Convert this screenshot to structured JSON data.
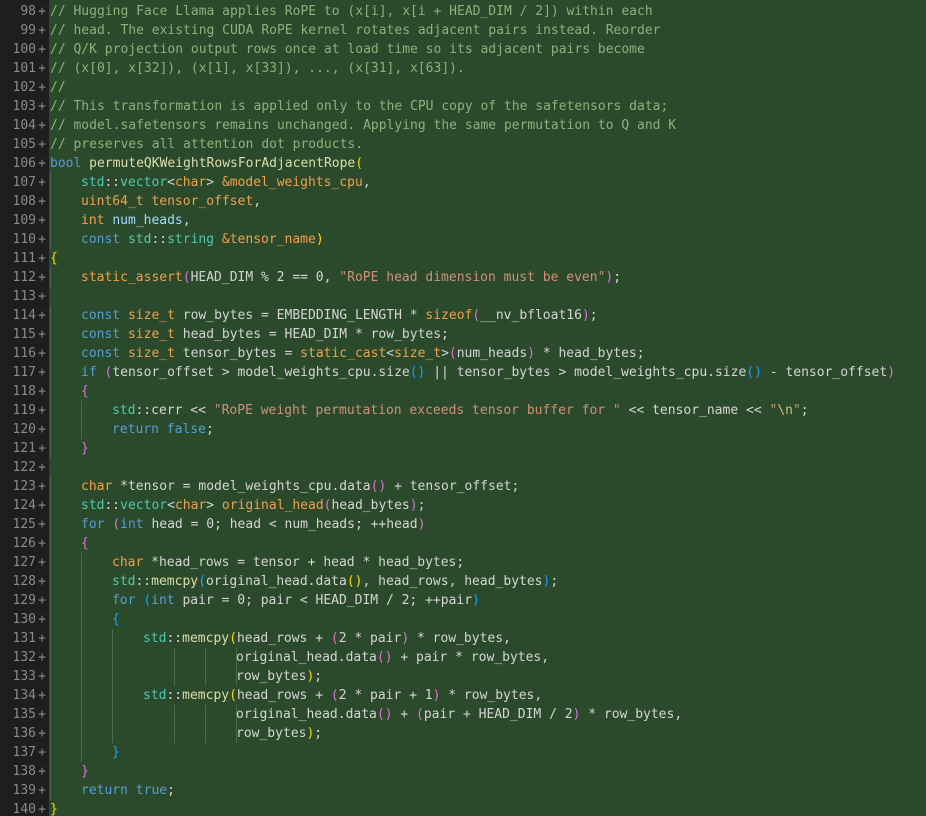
{
  "editor": {
    "diff_marker": "+",
    "lines": [
      {
        "n": "98",
        "i": 0,
        "t": [
          [
            "cm",
            "// Hugging Face Llama applies RoPE to (x[i], x[i + HEAD_DIM / 2]) within each"
          ]
        ]
      },
      {
        "n": "99",
        "i": 0,
        "t": [
          [
            "cm",
            "// head. The existing CUDA RoPE kernel rotates adjacent pairs instead. Reorder"
          ]
        ]
      },
      {
        "n": "100",
        "i": 0,
        "t": [
          [
            "cm",
            "// Q/K projection output rows once at load time so its adjacent pairs become"
          ]
        ]
      },
      {
        "n": "101",
        "i": 0,
        "t": [
          [
            "cm",
            "// (x[0], x[32]), (x[1], x[33]), ..., (x[31], x[63])."
          ]
        ]
      },
      {
        "n": "102",
        "i": 0,
        "t": [
          [
            "cm",
            "//"
          ]
        ]
      },
      {
        "n": "103",
        "i": 0,
        "t": [
          [
            "cm",
            "// This transformation is applied only to the CPU copy of the safetensors data;"
          ]
        ]
      },
      {
        "n": "104",
        "i": 0,
        "t": [
          [
            "cm",
            "// model.safetensors remains unchanged. Applying the same permutation to Q and K"
          ]
        ]
      },
      {
        "n": "105",
        "i": 0,
        "t": [
          [
            "cm",
            "// preserves all attention dot products."
          ]
        ]
      },
      {
        "n": "106",
        "i": 0,
        "t": [
          [
            "kw",
            "bool"
          ],
          [
            "",
            " "
          ],
          [
            "fn",
            "permuteQKWeightRowsForAdjacentRope"
          ],
          [
            "br",
            "("
          ]
        ]
      },
      {
        "n": "107",
        "i": 1,
        "t": [
          [
            "ns",
            "std"
          ],
          [
            "",
            "::"
          ],
          [
            "ns",
            "vector"
          ],
          [
            "",
            "<"
          ],
          [
            "ty",
            "char"
          ],
          [
            "",
            "> "
          ],
          [
            "ty",
            "&model_weights_cpu"
          ],
          [
            "",
            ","
          ]
        ]
      },
      {
        "n": "108",
        "i": 1,
        "t": [
          [
            "ty",
            "uint64_t tensor_offset"
          ],
          [
            "",
            ","
          ]
        ]
      },
      {
        "n": "109",
        "i": 1,
        "t": [
          [
            "ty",
            "int"
          ],
          [
            "",
            " "
          ],
          [
            "pr",
            "num_heads"
          ],
          [
            "",
            ","
          ]
        ]
      },
      {
        "n": "110",
        "i": 1,
        "t": [
          [
            "kw",
            "const"
          ],
          [
            "",
            " "
          ],
          [
            "ns",
            "std"
          ],
          [
            "",
            "::"
          ],
          [
            "ns",
            "string"
          ],
          [
            "",
            " "
          ],
          [
            "ty",
            "&tensor_name"
          ],
          [
            "br",
            ")"
          ]
        ]
      },
      {
        "n": "111",
        "i": 0,
        "t": [
          [
            "br",
            "{"
          ]
        ]
      },
      {
        "n": "112",
        "i": 1,
        "t": [
          [
            "ty",
            "static_assert"
          ],
          [
            "br2",
            "("
          ],
          [
            "",
            "HEAD_DIM % 2 == 0, "
          ],
          [
            "st",
            "\"RoPE head dimension must be even\""
          ],
          [
            "br2",
            ")"
          ],
          [
            "",
            ";"
          ]
        ]
      },
      {
        "n": "113",
        "i": 0,
        "t": [
          [
            "",
            ""
          ]
        ]
      },
      {
        "n": "114",
        "i": 1,
        "t": [
          [
            "kw",
            "const"
          ],
          [
            "",
            " "
          ],
          [
            "ty",
            "size_t"
          ],
          [
            "",
            " row_bytes = EMBEDDING_LENGTH * "
          ],
          [
            "ty",
            "sizeof"
          ],
          [
            "br2",
            "("
          ],
          [
            "",
            "__nv_bfloat16"
          ],
          [
            "br2",
            ")"
          ],
          [
            "",
            ";"
          ]
        ]
      },
      {
        "n": "115",
        "i": 1,
        "t": [
          [
            "kw",
            "const"
          ],
          [
            "",
            " "
          ],
          [
            "ty",
            "size_t"
          ],
          [
            "",
            " head_bytes = HEAD_DIM * row_bytes;"
          ]
        ]
      },
      {
        "n": "116",
        "i": 1,
        "t": [
          [
            "kw",
            "const"
          ],
          [
            "",
            " "
          ],
          [
            "ty",
            "size_t"
          ],
          [
            "",
            " tensor_bytes = "
          ],
          [
            "ty",
            "static_cast"
          ],
          [
            "",
            "<"
          ],
          [
            "ty",
            "size_t"
          ],
          [
            "",
            ">"
          ],
          [
            "br2",
            "("
          ],
          [
            "",
            "num_heads"
          ],
          [
            "br2",
            ")"
          ],
          [
            "",
            " * head_bytes;"
          ]
        ]
      },
      {
        "n": "117",
        "i": 1,
        "t": [
          [
            "kw",
            "if"
          ],
          [
            "",
            " "
          ],
          [
            "br2",
            "("
          ],
          [
            "",
            "tensor_offset > model_weights_cpu.size"
          ],
          [
            "br3",
            "()"
          ],
          [
            "",
            " || tensor_bytes > model_weights_cpu.size"
          ],
          [
            "br3",
            "()"
          ],
          [
            "",
            " - tensor_offset"
          ],
          [
            "br2",
            ")"
          ]
        ]
      },
      {
        "n": "118",
        "i": 1,
        "t": [
          [
            "br2",
            "{"
          ]
        ]
      },
      {
        "n": "119",
        "i": 2,
        "t": [
          [
            "ns",
            "std"
          ],
          [
            "",
            "::cerr << "
          ],
          [
            "st",
            "\"RoPE weight permutation exceeds tensor buffer for \""
          ],
          [
            "",
            " << tensor_name << "
          ],
          [
            "st",
            "\""
          ],
          [
            "es",
            "\\n"
          ],
          [
            "st",
            "\""
          ],
          [
            "",
            ";"
          ]
        ]
      },
      {
        "n": "120",
        "i": 2,
        "t": [
          [
            "kw",
            "return"
          ],
          [
            "",
            " "
          ],
          [
            "kw",
            "false"
          ],
          [
            "",
            ";"
          ]
        ]
      },
      {
        "n": "121",
        "i": 1,
        "t": [
          [
            "br2",
            "}"
          ]
        ]
      },
      {
        "n": "122",
        "i": 0,
        "t": [
          [
            "",
            ""
          ]
        ]
      },
      {
        "n": "123",
        "i": 1,
        "t": [
          [
            "ty",
            "char"
          ],
          [
            "",
            " *tensor = model_weights_cpu.data"
          ],
          [
            "br2",
            "()"
          ],
          [
            "",
            " + tensor_offset;"
          ]
        ]
      },
      {
        "n": "124",
        "i": 1,
        "t": [
          [
            "ns",
            "std"
          ],
          [
            "",
            "::"
          ],
          [
            "ns",
            "vector"
          ],
          [
            "",
            "<"
          ],
          [
            "ty",
            "char"
          ],
          [
            "",
            "> "
          ],
          [
            "ty",
            "original_head"
          ],
          [
            "br2",
            "("
          ],
          [
            "",
            "head_bytes"
          ],
          [
            "br2",
            ")"
          ],
          [
            "",
            ";"
          ]
        ]
      },
      {
        "n": "125",
        "i": 1,
        "t": [
          [
            "kw",
            "for"
          ],
          [
            "",
            " "
          ],
          [
            "br2",
            "("
          ],
          [
            "kw",
            "int"
          ],
          [
            "",
            " head = 0; head < num_heads; ++head"
          ],
          [
            "br2",
            ")"
          ]
        ]
      },
      {
        "n": "126",
        "i": 1,
        "t": [
          [
            "br2",
            "{"
          ]
        ]
      },
      {
        "n": "127",
        "i": 2,
        "t": [
          [
            "ty",
            "char"
          ],
          [
            "",
            " *head_rows = tensor + head * head_bytes;"
          ]
        ]
      },
      {
        "n": "128",
        "i": 2,
        "t": [
          [
            "ns",
            "std"
          ],
          [
            "",
            "::"
          ],
          [
            "fn",
            "memcpy"
          ],
          [
            "br3",
            "("
          ],
          [
            "",
            "original_head.data"
          ],
          [
            "br",
            "()"
          ],
          [
            "",
            ", head_rows, head_bytes"
          ],
          [
            "br3",
            ")"
          ],
          [
            "",
            ";"
          ]
        ]
      },
      {
        "n": "129",
        "i": 2,
        "t": [
          [
            "kw",
            "for"
          ],
          [
            "",
            " "
          ],
          [
            "br3",
            "("
          ],
          [
            "kw",
            "int"
          ],
          [
            "",
            " pair = 0; pair < HEAD_DIM / 2; ++pair"
          ],
          [
            "br3",
            ")"
          ]
        ]
      },
      {
        "n": "130",
        "i": 2,
        "t": [
          [
            "br3",
            "{"
          ]
        ]
      },
      {
        "n": "131",
        "i": 3,
        "t": [
          [
            "ns",
            "std"
          ],
          [
            "",
            "::"
          ],
          [
            "fn",
            "memcpy"
          ],
          [
            "br",
            "("
          ],
          [
            "",
            "head_rows + "
          ],
          [
            "br2",
            "("
          ],
          [
            "",
            "2 * pair"
          ],
          [
            "br2",
            ")"
          ],
          [
            "",
            " * row_bytes,"
          ]
        ]
      },
      {
        "n": "132",
        "i": 3,
        "w": 12,
        "t": [
          [
            "",
            "original_head.data"
          ],
          [
            "br2",
            "()"
          ],
          [
            "",
            " + pair * row_bytes,"
          ]
        ]
      },
      {
        "n": "133",
        "i": 3,
        "w": 12,
        "t": [
          [
            "",
            "row_bytes"
          ],
          [
            "br",
            ")"
          ],
          [
            "",
            ";"
          ]
        ]
      },
      {
        "n": "134",
        "i": 3,
        "t": [
          [
            "ns",
            "std"
          ],
          [
            "",
            "::"
          ],
          [
            "fn",
            "memcpy"
          ],
          [
            "br",
            "("
          ],
          [
            "",
            "head_rows + "
          ],
          [
            "br2",
            "("
          ],
          [
            "",
            "2 * pair + 1"
          ],
          [
            "br2",
            ")"
          ],
          [
            "",
            " * row_bytes,"
          ]
        ]
      },
      {
        "n": "135",
        "i": 3,
        "w": 12,
        "t": [
          [
            "",
            "original_head.data"
          ],
          [
            "br2",
            "()"
          ],
          [
            "",
            " + "
          ],
          [
            "br2",
            "("
          ],
          [
            "",
            "pair + HEAD_DIM / 2"
          ],
          [
            "br2",
            ")"
          ],
          [
            "",
            " * row_bytes,"
          ]
        ]
      },
      {
        "n": "136",
        "i": 3,
        "w": 12,
        "t": [
          [
            "",
            "row_bytes"
          ],
          [
            "br",
            ")"
          ],
          [
            "",
            ";"
          ]
        ]
      },
      {
        "n": "137",
        "i": 2,
        "t": [
          [
            "br3",
            "}"
          ]
        ]
      },
      {
        "n": "138",
        "i": 1,
        "t": [
          [
            "br2",
            "}"
          ]
        ]
      },
      {
        "n": "139",
        "i": 1,
        "t": [
          [
            "kw",
            "return"
          ],
          [
            "",
            " "
          ],
          [
            "kw",
            "true"
          ],
          [
            "",
            ";"
          ]
        ]
      },
      {
        "n": "140",
        "i": 0,
        "t": [
          [
            "br",
            "}"
          ]
        ]
      }
    ]
  }
}
